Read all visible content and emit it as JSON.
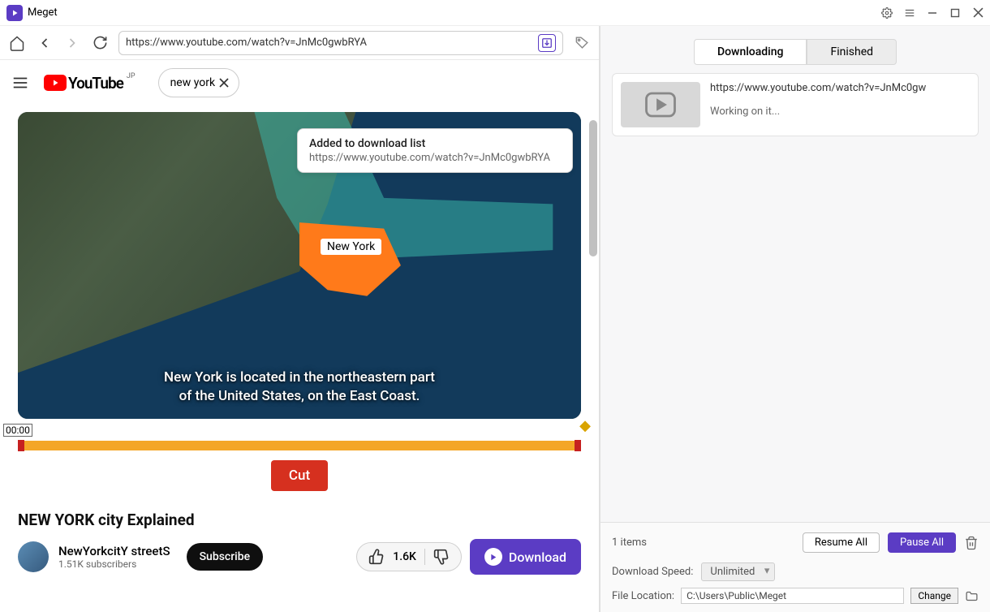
{
  "titlebar": {
    "appName": "Meget"
  },
  "nav": {
    "url": "https://www.youtube.com/watch?v=JnMc0gwbRYA"
  },
  "yt": {
    "logoText": "YouTube",
    "region": "JP",
    "searchValue": "new york"
  },
  "toast": {
    "title": "Added to download list",
    "url": "https://www.youtube.com/watch?v=JnMc0gwbRYA"
  },
  "video": {
    "mapLabel": "New York",
    "subtitleLine1": "New York is located in the northeastern part",
    "subtitleLine2": "of the United States, on the East Coast.",
    "trimTime": "00:00",
    "cutLabel": "Cut",
    "title": "NEW YORK city Explained",
    "channelName": "NewYorkcitY streetS",
    "subscribers": "1.51K subscribers",
    "subscribeLabel": "Subscribe",
    "likeCount": "1.6K",
    "downloadLabel": "Download"
  },
  "right": {
    "tabs": {
      "downloading": "Downloading",
      "finished": "Finished"
    },
    "item": {
      "url": "https://www.youtube.com/watch?v=JnMc0gw",
      "status": "Working on it..."
    },
    "itemsCount": "1 items",
    "resumeAll": "Resume All",
    "pauseAll": "Pause All",
    "speedLabel": "Download Speed:",
    "speedValue": "Unlimited",
    "locationLabel": "File Location:",
    "locationValue": "C:\\Users\\Public\\Meget",
    "changeLabel": "Change"
  }
}
